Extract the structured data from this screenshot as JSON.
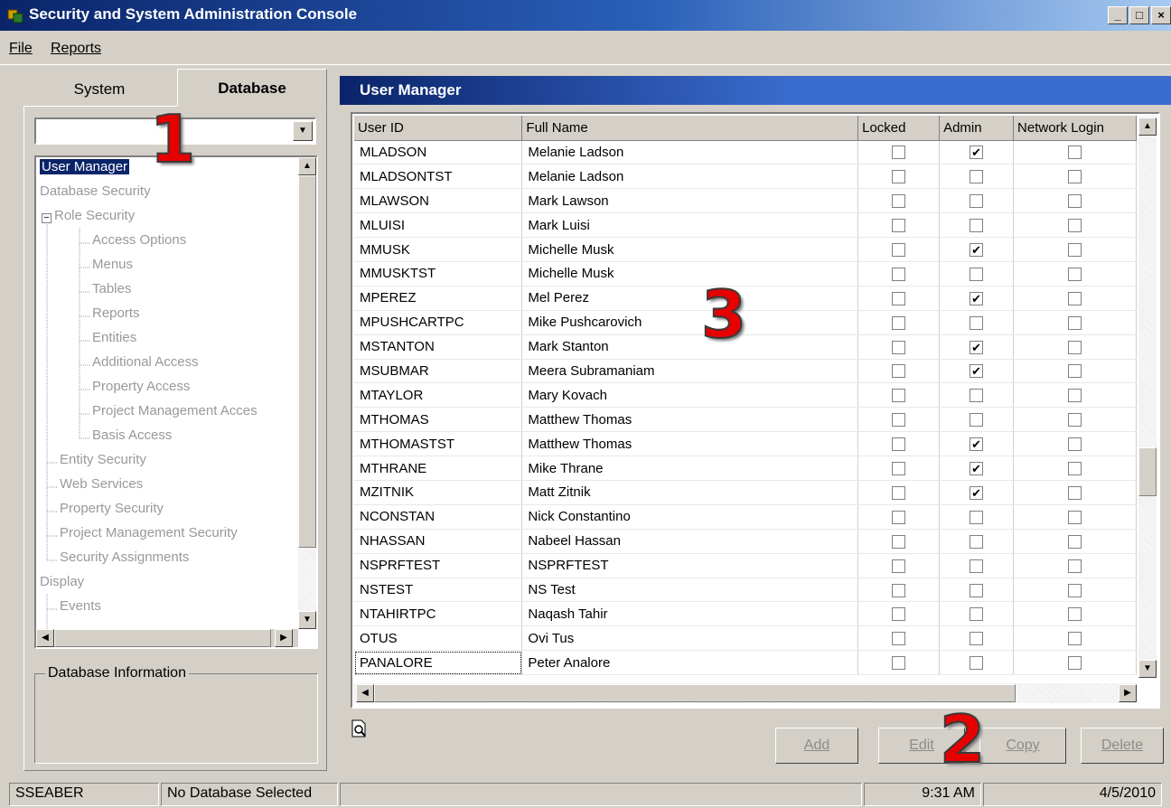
{
  "window": {
    "title": "Security and System Administration Console",
    "controls": [
      "_",
      "□",
      "×"
    ]
  },
  "menu": {
    "file": "File",
    "reports": "Reports"
  },
  "left": {
    "tabs": {
      "system": "System",
      "database": "Database"
    },
    "db_select_value": "",
    "tree": [
      {
        "label": "User Manager",
        "level": 0,
        "selected": true
      },
      {
        "label": "Database Security",
        "level": 0
      },
      {
        "label": "Role Security",
        "level": 1,
        "expander": "−"
      },
      {
        "label": "Access Options",
        "level": 2
      },
      {
        "label": "Menus",
        "level": 2
      },
      {
        "label": "Tables",
        "level": 2
      },
      {
        "label": "Reports",
        "level": 2
      },
      {
        "label": "Entities",
        "level": 2
      },
      {
        "label": "Additional Access",
        "level": 2
      },
      {
        "label": "Property Access",
        "level": 2
      },
      {
        "label": "Project Management Acces",
        "level": 2
      },
      {
        "label": "Basis Access",
        "level": 2
      },
      {
        "label": "Entity Security",
        "level": 1
      },
      {
        "label": "Web Services",
        "level": 1
      },
      {
        "label": "Property Security",
        "level": 1
      },
      {
        "label": "Project Management Security",
        "level": 1
      },
      {
        "label": "Security Assignments",
        "level": 1
      },
      {
        "label": "Display",
        "level": 0
      },
      {
        "label": "Events",
        "level": 1
      }
    ],
    "db_info_label": "Database Information"
  },
  "main": {
    "header": "User Manager",
    "columns": [
      "User ID",
      "Full Name",
      "Locked",
      "Admin",
      "Network Login"
    ],
    "rows": [
      {
        "id": "MLADSON",
        "name": "Melanie Ladson",
        "locked": false,
        "admin": true,
        "net": false
      },
      {
        "id": "MLADSONTST",
        "name": "Melanie Ladson",
        "locked": false,
        "admin": false,
        "net": false
      },
      {
        "id": "MLAWSON",
        "name": "Mark Lawson",
        "locked": false,
        "admin": false,
        "net": false
      },
      {
        "id": "MLUISI",
        "name": "Mark Luisi",
        "locked": false,
        "admin": false,
        "net": false
      },
      {
        "id": "MMUSK",
        "name": "Michelle Musk",
        "locked": false,
        "admin": true,
        "net": false
      },
      {
        "id": "MMUSKTST",
        "name": "Michelle Musk",
        "locked": false,
        "admin": false,
        "net": false
      },
      {
        "id": "MPEREZ",
        "name": "Mel Perez",
        "locked": false,
        "admin": true,
        "net": false
      },
      {
        "id": "MPUSHCARTPC",
        "name": "Mike Pushcarovich",
        "locked": false,
        "admin": false,
        "net": false
      },
      {
        "id": "MSTANTON",
        "name": "Mark Stanton",
        "locked": false,
        "admin": true,
        "net": false
      },
      {
        "id": "MSUBMAR",
        "name": "Meera Subramaniam",
        "locked": false,
        "admin": true,
        "net": false
      },
      {
        "id": "MTAYLOR",
        "name": "Mary Kovach",
        "locked": false,
        "admin": false,
        "net": false
      },
      {
        "id": "MTHOMAS",
        "name": "Matthew Thomas",
        "locked": false,
        "admin": false,
        "net": false
      },
      {
        "id": "MTHOMASTST",
        "name": "Matthew Thomas",
        "locked": false,
        "admin": true,
        "net": false
      },
      {
        "id": "MTHRANE",
        "name": "Mike Thrane",
        "locked": false,
        "admin": true,
        "net": false
      },
      {
        "id": "MZITNIK",
        "name": "Matt Zitnik",
        "locked": false,
        "admin": true,
        "net": false
      },
      {
        "id": "NCONSTAN",
        "name": "Nick Constantino",
        "locked": false,
        "admin": false,
        "net": false
      },
      {
        "id": "NHASSAN",
        "name": "Nabeel Hassan",
        "locked": false,
        "admin": false,
        "net": false
      },
      {
        "id": "NSPRFTEST",
        "name": "NSPRFTEST",
        "locked": false,
        "admin": false,
        "net": false
      },
      {
        "id": "NSTEST",
        "name": "NS Test",
        "locked": false,
        "admin": false,
        "net": false
      },
      {
        "id": "NTAHIRTPC",
        "name": "Naqash Tahir",
        "locked": false,
        "admin": false,
        "net": false
      },
      {
        "id": "OTUS",
        "name": "Ovi Tus",
        "locked": false,
        "admin": false,
        "net": false
      },
      {
        "id": "PANALORE",
        "name": "Peter Analore",
        "locked": false,
        "admin": false,
        "net": false,
        "focused": true
      }
    ],
    "buttons": {
      "add": "Add",
      "edit": "Edit",
      "copy": "Copy",
      "delete": "Delete"
    }
  },
  "status": {
    "user": "SSEABER",
    "database": "No Database Selected",
    "time": "9:31 AM",
    "date": "4/5/2010"
  },
  "callouts": [
    "1",
    "2",
    "3"
  ]
}
